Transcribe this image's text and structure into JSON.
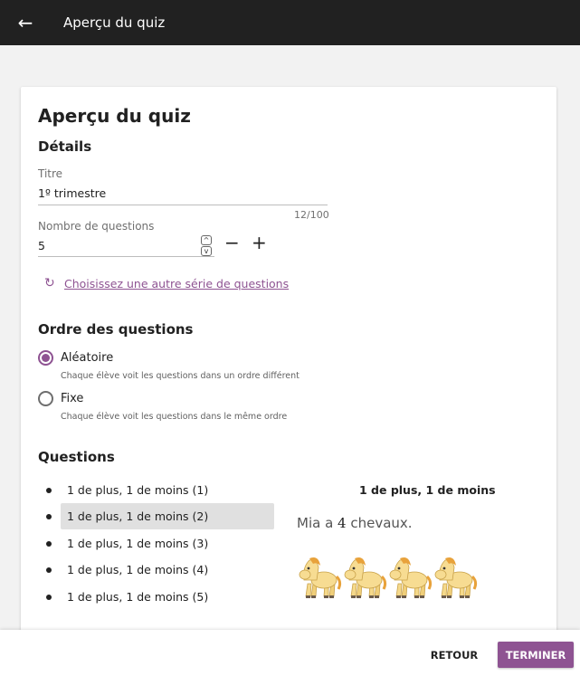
{
  "appbar": {
    "title": "Aperçu du quiz",
    "back_icon": "arrow-left-icon"
  },
  "card": {
    "title": "Aperçu du quiz",
    "details_heading": "Détails",
    "title_field": {
      "label": "Titre",
      "value": "1º trimestre",
      "counter": "12/100"
    },
    "questions_field": {
      "label": "Nombre de questions",
      "value": "5",
      "spin_up": "^",
      "spin_down": "v",
      "minus": "−",
      "plus": "+"
    },
    "refresh_link": "Choisissez une autre série de questions",
    "order_heading": "Ordre des questions",
    "order_options": [
      {
        "label": "Aléatoire",
        "desc": "Chaque élève voit les questions dans un ordre différent",
        "checked": true
      },
      {
        "label": "Fixe",
        "desc": "Chaque élève voit les questions dans le même ordre",
        "checked": false
      }
    ],
    "questions_heading": "Questions",
    "questions": [
      {
        "label": "1 de plus, 1 de moins (1)",
        "selected": false
      },
      {
        "label": "1 de plus, 1 de moins (2)",
        "selected": true
      },
      {
        "label": "1 de plus, 1 de moins (3)",
        "selected": false
      },
      {
        "label": "1 de plus, 1 de moins (4)",
        "selected": false
      },
      {
        "label": "1 de plus, 1 de moins (5)",
        "selected": false
      }
    ],
    "preview": {
      "title": "1 de plus, 1 de moins",
      "text_before": "Mia a ",
      "number": "4",
      "text_after": " chevaux.",
      "horse_count": 4
    }
  },
  "footer": {
    "back_label": "RETOUR",
    "finish_label": "TERMINER"
  },
  "colors": {
    "accent": "#8e5392",
    "appbar": "#212121",
    "background": "#f2f2f2"
  }
}
